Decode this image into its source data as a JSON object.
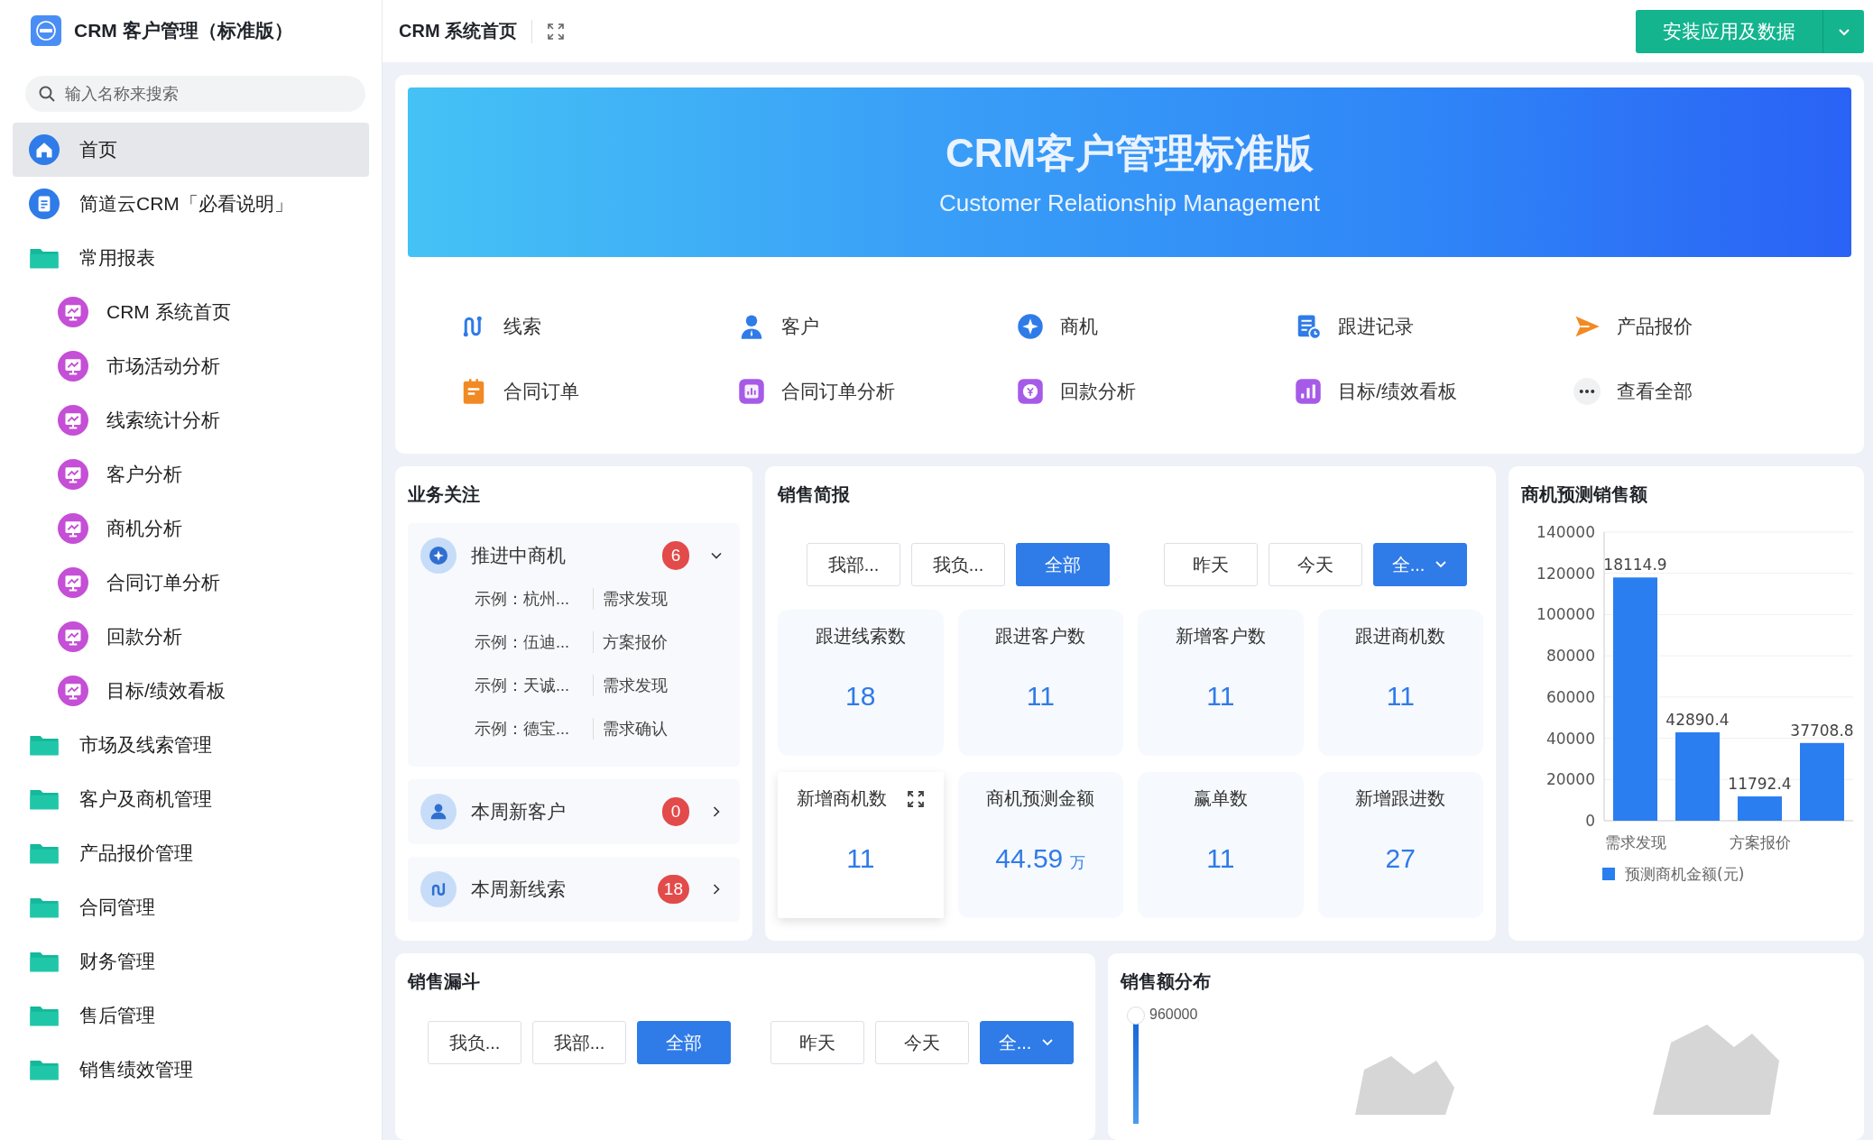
{
  "sidebar": {
    "app_title": "CRM 客户管理（标准版）",
    "search": {
      "placeholder": "输入名称来搜索"
    },
    "items": [
      {
        "kind": "home",
        "label": "首页",
        "selected": true
      },
      {
        "kind": "doc",
        "label": "简道云CRM「必看说明」",
        "selected": false
      },
      {
        "kind": "folder",
        "label": "常用报表",
        "selected": false,
        "children": [
          {
            "kind": "report",
            "label": "CRM 系统首页",
            "selected": false
          },
          {
            "kind": "report",
            "label": "市场活动分析",
            "selected": false
          },
          {
            "kind": "report",
            "label": "线索统计分析",
            "selected": false
          },
          {
            "kind": "report",
            "label": "客户分析",
            "selected": false
          },
          {
            "kind": "report",
            "label": "商机分析",
            "selected": false
          },
          {
            "kind": "report",
            "label": "合同订单分析",
            "selected": false
          },
          {
            "kind": "report",
            "label": "回款分析",
            "selected": false
          },
          {
            "kind": "report",
            "label": "目标/绩效看板",
            "selected": false
          }
        ]
      },
      {
        "kind": "folder",
        "label": "市场及线索管理",
        "selected": false
      },
      {
        "kind": "folder",
        "label": "客户及商机管理",
        "selected": false
      },
      {
        "kind": "folder",
        "label": "产品报价管理",
        "selected": false
      },
      {
        "kind": "folder",
        "label": "合同管理",
        "selected": false
      },
      {
        "kind": "folder",
        "label": "财务管理",
        "selected": false
      },
      {
        "kind": "folder",
        "label": "售后管理",
        "selected": false
      },
      {
        "kind": "folder",
        "label": "销售绩效管理",
        "selected": false
      }
    ]
  },
  "topbar": {
    "title": "CRM 系统首页",
    "install_button": "安装应用及数据"
  },
  "banner": {
    "title": "CRM客户管理标准版",
    "subtitle": "Customer Relationship Management"
  },
  "shortcuts": [
    {
      "kind": "lead",
      "label": "线索"
    },
    {
      "kind": "customer",
      "label": "客户"
    },
    {
      "kind": "opportunity",
      "label": "商机"
    },
    {
      "kind": "followup",
      "label": "跟进记录"
    },
    {
      "kind": "quote",
      "label": "产品报价"
    },
    {
      "kind": "order",
      "label": "合同订单"
    },
    {
      "kind": "order_analysis",
      "label": "合同订单分析"
    },
    {
      "kind": "payment",
      "label": "回款分析"
    },
    {
      "kind": "target",
      "label": "目标/绩效看板"
    },
    {
      "kind": "more",
      "label": "查看全部"
    }
  ],
  "focus": {
    "title": "业务关注",
    "groups": [
      {
        "kind": "opportunity",
        "title": "推进中商机",
        "count": "6",
        "expanded": true,
        "rows": [
          {
            "name": "示例：杭州...",
            "stage": "需求发现"
          },
          {
            "name": "示例：伍迪...",
            "stage": "方案报价"
          },
          {
            "name": "示例：天诚...",
            "stage": "需求发现"
          },
          {
            "name": "示例：德宝...",
            "stage": "需求确认"
          }
        ]
      },
      {
        "kind": "customer",
        "title": "本周新客户",
        "count": "0",
        "expanded": false
      },
      {
        "kind": "lead",
        "title": "本周新线索",
        "count": "18",
        "expanded": false
      }
    ]
  },
  "sales_brief": {
    "title": "销售简报",
    "scope_filters": [
      {
        "label": "我部...",
        "selected": false
      },
      {
        "label": "我负...",
        "selected": false
      },
      {
        "label": "全部",
        "selected": true
      }
    ],
    "time_filters": [
      {
        "label": "昨天",
        "selected": false
      },
      {
        "label": "今天",
        "selected": false
      },
      {
        "label": "全...",
        "selected": true,
        "kind": "dropdown"
      }
    ],
    "stats": [
      {
        "label": "跟进线索数",
        "value": "18",
        "hovered": false
      },
      {
        "label": "跟进客户数",
        "value": "11",
        "hovered": false
      },
      {
        "label": "新增客户数",
        "value": "11",
        "hovered": false
      },
      {
        "label": "跟进商机数",
        "value": "11",
        "hovered": false
      },
      {
        "label": "新增商机数",
        "value": "11",
        "hovered": true
      },
      {
        "label": "商机预测金额",
        "value": "44.59",
        "unit": "万",
        "hovered": false
      },
      {
        "label": "赢单数",
        "value": "11",
        "hovered": false
      },
      {
        "label": "新增跟进数",
        "value": "27",
        "hovered": false
      }
    ]
  },
  "forecast": {
    "title": "商机预测销售额",
    "chart_data": {
      "type": "bar",
      "categories": [
        "需求发现",
        null,
        "方案报价",
        null
      ],
      "series": [
        {
          "name": "预测商机金额(元)",
          "color": "#2a7ef0",
          "values": [
            118000,
            42890.4,
            11792.4,
            37708.8
          ]
        }
      ],
      "ylim": [
        0,
        140000
      ],
      "yticks": [
        0,
        20000,
        40000,
        60000,
        80000,
        100000,
        120000,
        140000
      ],
      "grid": true,
      "value_labels": [
        "18114.9",
        "42890.4",
        "11792.4",
        "37708.8"
      ]
    }
  },
  "funnel": {
    "title": "销售漏斗",
    "scope_filters": [
      {
        "label": "我负...",
        "selected": false
      },
      {
        "label": "我部...",
        "selected": false
      },
      {
        "label": "全部",
        "selected": true
      }
    ],
    "time_filters": [
      {
        "label": "昨天",
        "selected": false
      },
      {
        "label": "今天",
        "selected": false
      },
      {
        "label": "全...",
        "selected": true,
        "kind": "dropdown"
      }
    ]
  },
  "distribution": {
    "title": "销售额分布",
    "scale_max": "960000"
  }
}
